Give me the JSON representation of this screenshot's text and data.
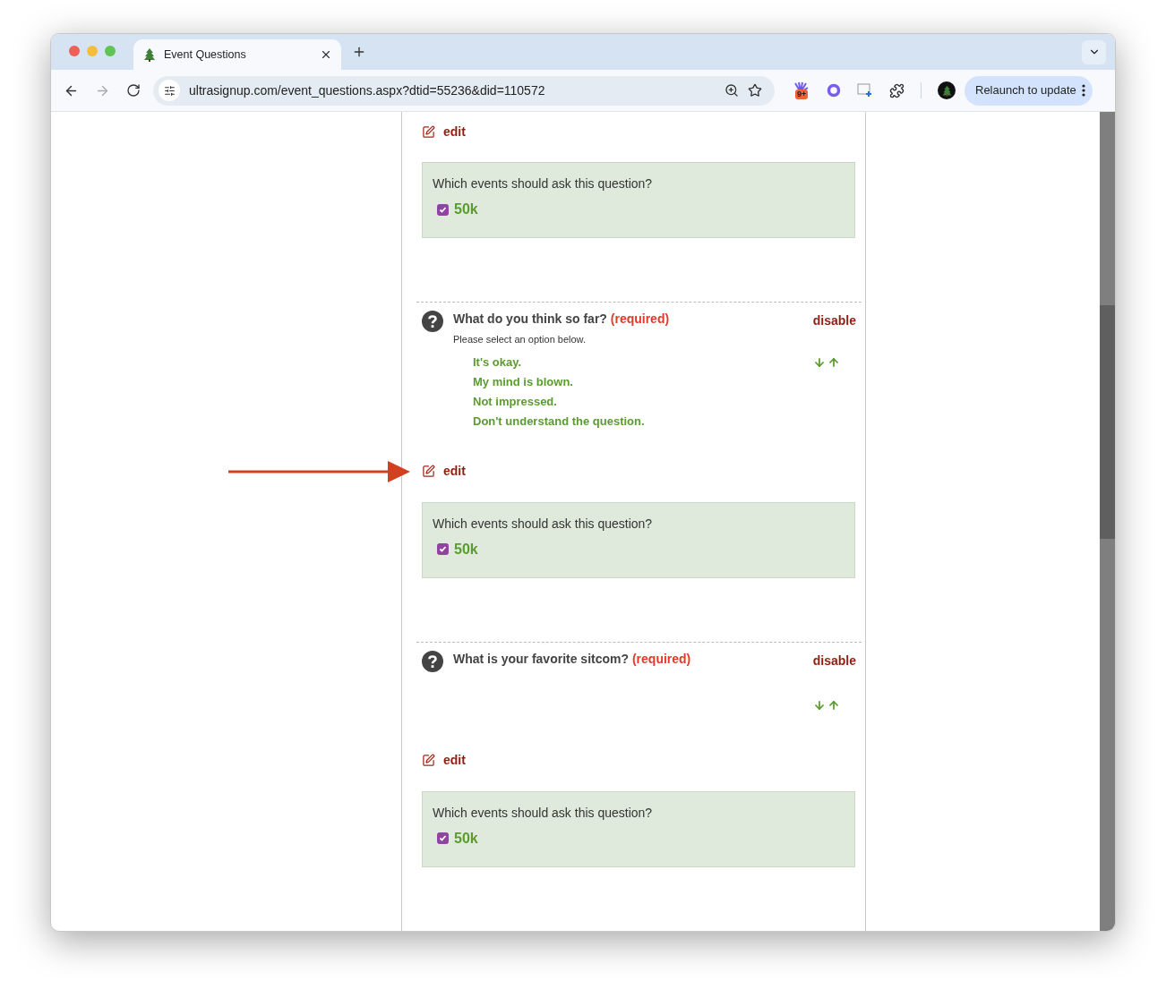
{
  "browser": {
    "tab_title": "Event Questions",
    "url": "ultrasignup.com/event_questions.aspx?dtid=55236&did=110572",
    "extension_badge": "9+",
    "relaunch_button": "Relaunch to update"
  },
  "top_section": {
    "edit": "edit",
    "events_prompt": "Which events should ask this question?",
    "events": [
      {
        "label": "50k",
        "checked": true
      }
    ]
  },
  "questions": [
    {
      "title": "What do you think so far?",
      "required": "(required)",
      "disable": "disable",
      "hint": "Please select an option below.",
      "options": [
        "It's okay.",
        "My mind is blown.",
        "Not impressed.",
        "Don't understand the question."
      ],
      "edit": "edit",
      "arrow_pointing": true,
      "events_prompt": "Which events should ask this question?",
      "events": [
        {
          "label": "50k",
          "checked": true
        }
      ]
    },
    {
      "title": "What is your favorite sitcom?",
      "required": "(required)",
      "disable": "disable",
      "edit": "edit",
      "arrow_pointing": false,
      "events_prompt": "Which events should ask this question?",
      "events": [
        {
          "label": "50k",
          "checked": true
        }
      ]
    }
  ]
}
